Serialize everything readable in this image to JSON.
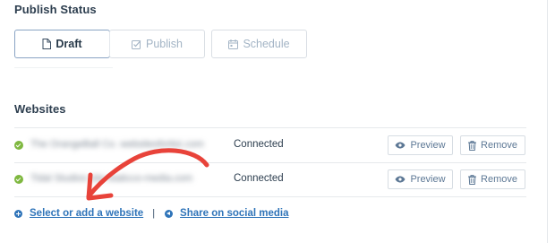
{
  "publish": {
    "title": "Publish Status",
    "options": [
      {
        "label": "Draft",
        "icon": "file-icon",
        "active": true
      },
      {
        "label": "Publish",
        "icon": "check-square-icon",
        "active": false
      },
      {
        "label": "Schedule",
        "icon": "calendar-icon",
        "active": false
      }
    ]
  },
  "websites": {
    "title": "Websites",
    "rows": [
      {
        "site": "The OrangeBall Co. websitesforbiz.com",
        "status": "Connected",
        "preview_label": "Preview",
        "remove_label": "Remove"
      },
      {
        "site": "Tidal Studios site staticco-media.com",
        "status": "Connected",
        "preview_label": "Preview",
        "remove_label": "Remove"
      }
    ]
  },
  "links": {
    "add_site": "Select or add a website",
    "separator": "|",
    "share": "Share on social media"
  },
  "colors": {
    "accent": "#2f74b9",
    "success": "#7fb840",
    "annotation": "#e8433a"
  }
}
